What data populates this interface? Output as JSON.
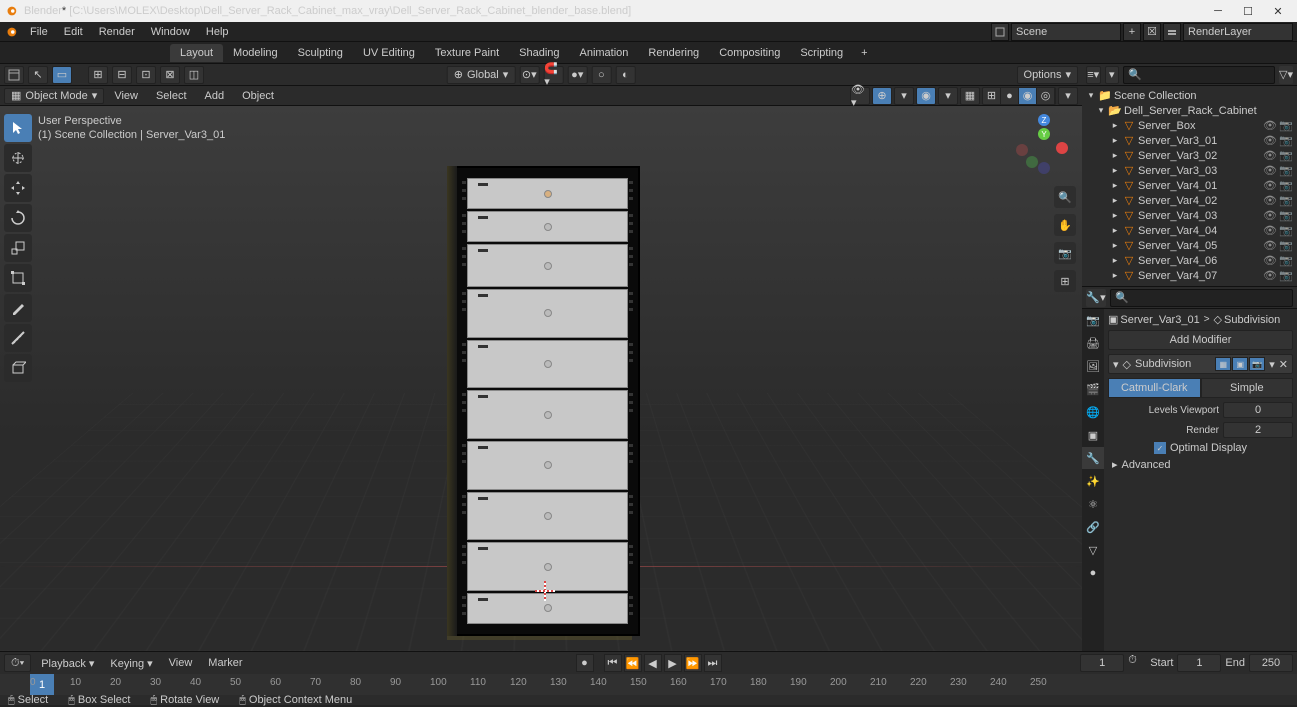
{
  "app": {
    "name": "Blender",
    "title_suffix": "[C:\\Users\\MOLEX\\Desktop\\Dell_Server_Rack_Cabinet_max_vray\\Dell_Server_Rack_Cabinet_blender_base.blend]"
  },
  "menus": [
    "File",
    "Edit",
    "Render",
    "Window",
    "Help"
  ],
  "workspaces": [
    "Layout",
    "Modeling",
    "Sculpting",
    "UV Editing",
    "Texture Paint",
    "Shading",
    "Animation",
    "Rendering",
    "Compositing",
    "Scripting"
  ],
  "active_workspace": "Layout",
  "scene": {
    "name": "Scene",
    "view_layer": "RenderLayer"
  },
  "viewport": {
    "mode": "Object Mode",
    "mode_menus": [
      "View",
      "Select",
      "Add",
      "Object"
    ],
    "info_line1": "User Perspective",
    "info_line2": "(1) Scene Collection | Server_Var3_01",
    "orientation": "Global",
    "options_label": "Options"
  },
  "outliner": {
    "root": "Scene Collection",
    "collection": "Dell_Server_Rack_Cabinet",
    "items": [
      {
        "name": "Server_Box",
        "type": "mesh"
      },
      {
        "name": "Server_Var3_01",
        "type": "mesh"
      },
      {
        "name": "Server_Var3_02",
        "type": "mesh"
      },
      {
        "name": "Server_Var3_03",
        "type": "mesh"
      },
      {
        "name": "Server_Var4_01",
        "type": "mesh"
      },
      {
        "name": "Server_Var4_02",
        "type": "mesh"
      },
      {
        "name": "Server_Var4_03",
        "type": "mesh"
      },
      {
        "name": "Server_Var4_04",
        "type": "mesh"
      },
      {
        "name": "Server_Var4_05",
        "type": "mesh"
      },
      {
        "name": "Server_Var4_06",
        "type": "mesh"
      },
      {
        "name": "Server_Var4_07",
        "type": "mesh"
      }
    ]
  },
  "properties": {
    "object": "Server_Var3_01",
    "modifier": "Subdivision",
    "add_modifier_label": "Add Modifier",
    "mod_name": "Subdivision",
    "mod_type_a": "Catmull-Clark",
    "mod_type_b": "Simple",
    "levels_viewport_label": "Levels Viewport",
    "levels_viewport": "0",
    "render_label": "Render",
    "render": "2",
    "optimal_display": "Optimal Display",
    "advanced": "Advanced"
  },
  "timeline": {
    "menus": [
      "Playback",
      "Keying",
      "View",
      "Marker"
    ],
    "current": "1",
    "start_label": "Start",
    "start": "1",
    "end_label": "End",
    "end": "250",
    "ticks": [
      "0",
      "10",
      "20",
      "30",
      "40",
      "50",
      "60",
      "70",
      "80",
      "90",
      "100",
      "110",
      "120",
      "130",
      "140",
      "150",
      "160",
      "170",
      "180",
      "190",
      "200",
      "210",
      "220",
      "230",
      "240",
      "250"
    ]
  },
  "status": {
    "select": "Select",
    "box": "Box Select",
    "rotate": "Rotate View",
    "context": "Object Context Menu"
  },
  "gizmo": {
    "z": "Z",
    "y": "Y"
  }
}
